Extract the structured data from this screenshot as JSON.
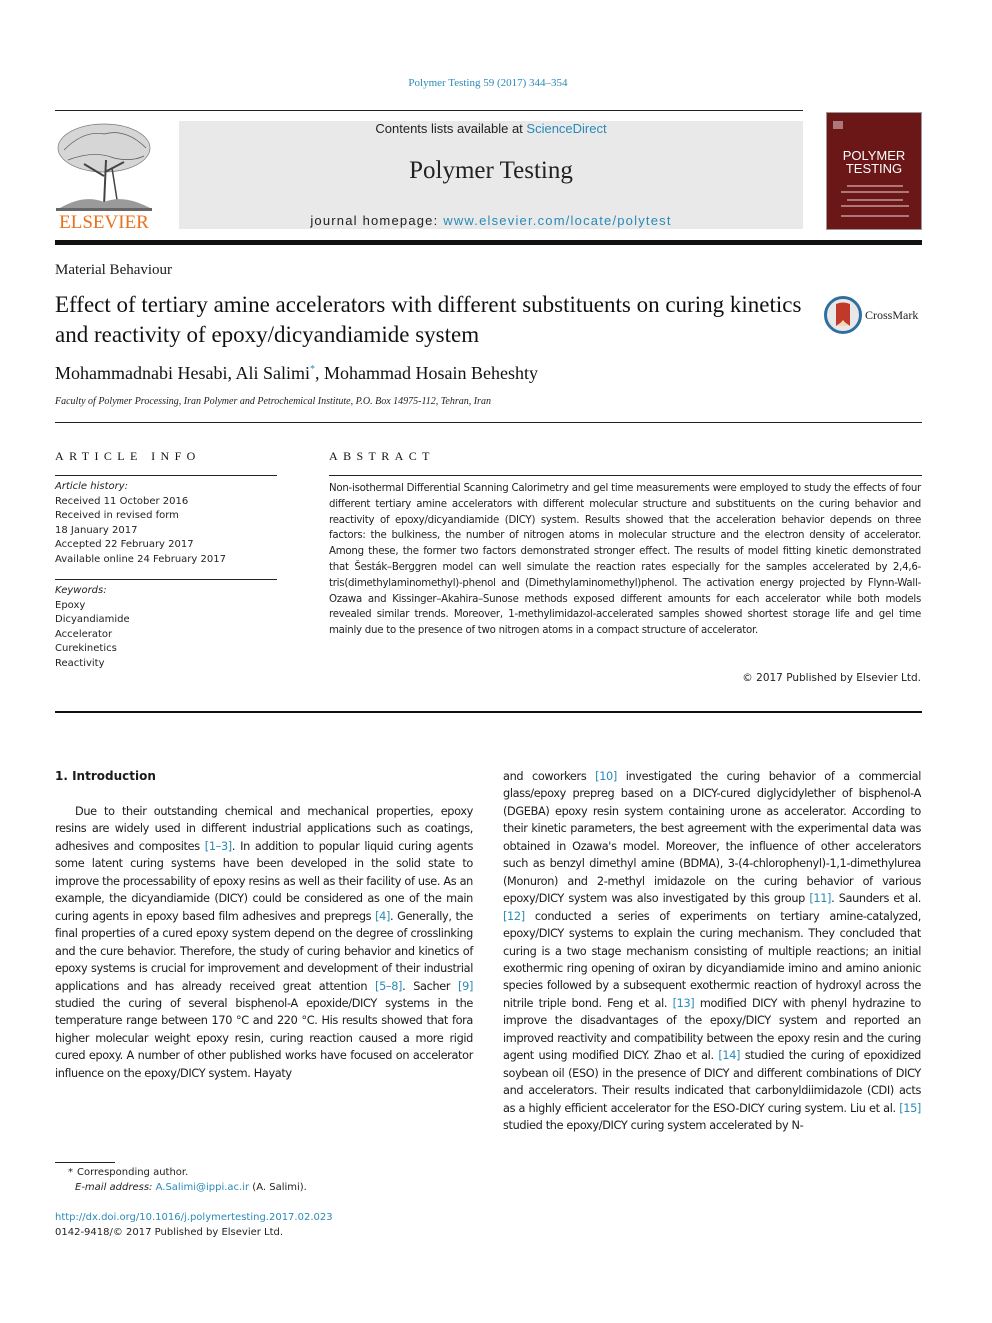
{
  "journal_reference": "Polymer Testing 59 (2017) 344–354",
  "publisher_logo": {
    "icon": "elsevier-tree-icon",
    "wordmark": "ELSEVIER",
    "color": "#e9711c"
  },
  "banner": {
    "contents_prefix": "Contents lists available at ",
    "contents_link": "ScienceDirect",
    "journal_title": "Polymer Testing",
    "homepage_prefix": "journal homepage: ",
    "homepage_link": "www.elsevier.com/locate/polytest"
  },
  "cover": {
    "title_line1": "POLYMER",
    "title_line2": "TESTING",
    "color": "#6b1717"
  },
  "section_label": "Material Behaviour",
  "article_title": "Effect of tertiary amine accelerators with different substituents on curing kinetics and reactivity of epoxy/dicyandiamide system",
  "crossmark": {
    "icon": "crossmark-icon",
    "label": "CrossMark"
  },
  "authors": {
    "author1": "Mohammadnabi Hesabi, ",
    "author2": "Ali Salimi",
    "author2_mark": "*",
    "author3": ", Mohammad Hosain Beheshty"
  },
  "affiliation": "Faculty of Polymer Processing, Iran Polymer and Petrochemical Institute, P.O. Box 14975-112, Tehran, Iran",
  "article_info": {
    "heading": "ARTICLE INFO",
    "history_label": "Article history:",
    "history": [
      "Received 11 October 2016",
      "Received in revised form",
      "18 January 2017",
      "Accepted 22 February 2017",
      "Available online 24 February 2017"
    ],
    "keywords_label": "Keywords:",
    "keywords": [
      "Epoxy",
      "Dicyandiamide",
      "Accelerator",
      "Curekinetics",
      "Reactivity"
    ]
  },
  "abstract": {
    "heading": "ABSTRACT",
    "text": "Non-isothermal Differential Scanning Calorimetry and gel time measurements were employed to study the effects of four different tertiary amine accelerators with different molecular structure and substituents on the curing behavior and reactivity of epoxy/dicyandiamide (DICY) system. Results showed that the acceleration behavior depends on three factors: the bulkiness, the number of nitrogen atoms in molecular structure and the electron density of accelerator. Among these, the former two factors demonstrated stronger effect. The results of model fitting kinetic demonstrated that Šesták–Berggren model can well simulate the reaction rates especially for the samples accelerated by 2,4,6-tris(dimethylaminomethyl)-phenol and (Dimethylaminomethyl)phenol. The activation energy projected by Flynn-Wall-Ozawa and Kissinger–Akahira–Sunose methods exposed different amounts for each accelerator while both models revealed similar trends. Moreover, 1-methylimidazol-accelerated samples showed shortest storage life and gel time mainly due to the presence of two nitrogen atoms in a compact structure of accelerator.",
    "copyright": "© 2017 Published by Elsevier Ltd."
  },
  "introduction": {
    "heading": "1.  Introduction",
    "left_column": [
      {
        "t": "Due to their outstanding chemical and mechanical properties, epoxy resins are widely used in different industrial applications such as coatings, adhesives and composites "
      },
      {
        "c": "[1–3]"
      },
      {
        "t": ". In addition to popular liquid curing agents some latent curing systems have been developed in the solid state to improve the processability of epoxy resins as well as their facility of use. As an example, the dicyandiamide (DICY) could be considered as one of the main curing agents in epoxy based film adhesives and prepregs "
      },
      {
        "c": "[4]"
      },
      {
        "t": ". Generally, the final properties of a cured epoxy system depend on the degree of crosslinking and the cure behavior. Therefore, the study of curing behavior and kinetics of epoxy systems is crucial for improvement and development of their industrial applications and has already received great attention "
      },
      {
        "c": "[5–8]"
      },
      {
        "t": ". Sacher "
      },
      {
        "c": "[9]"
      },
      {
        "t": " studied the curing of several bisphenol-A epoxide/DICY systems in the temperature range between 170 °C and 220 °C. His results showed that fora higher molecular weight epoxy resin, curing reaction caused a more rigid cured epoxy. A number of other published works have focused on accelerator influence on the epoxy/DICY system. Hayaty"
      }
    ],
    "right_column": [
      {
        "t": "and coworkers "
      },
      {
        "c": "[10]"
      },
      {
        "t": " investigated the curing behavior of a commercial glass/epoxy prepreg based on a DICY-cured diglycidylether of bisphenol-A (DGEBA) epoxy resin system containing urone as accelerator. According to their kinetic parameters, the best agreement with the experimental data was obtained in Ozawa's model. Moreover, the influence of other accelerators such as benzyl dimethyl amine (BDMA), 3-(4-chlorophenyl)-1,1-dimethylurea (Monuron) and 2-methyl imidazole on the curing behavior of various epoxy/DICY system was also investigated by this group "
      },
      {
        "c": "[11]"
      },
      {
        "t": ". Saunders et al. "
      },
      {
        "c": "[12]"
      },
      {
        "t": " conducted a series of experiments on tertiary amine-catalyzed, epoxy/DICY systems to explain the curing mechanism. They concluded that curing is a two stage mechanism consisting of multiple reactions; an initial exothermic ring opening of oxiran by dicyandiamide imino and amino anionic species followed by a subsequent exothermic reaction of hydroxyl across the nitrile triple bond. Feng et al. "
      },
      {
        "c": "[13]"
      },
      {
        "t": " modified DICY with phenyl hydrazine to improve the disadvantages of the epoxy/DICY system and reported an improved reactivity and compatibility between the epoxy resin and the curing agent using modified DICY. Zhao et al. "
      },
      {
        "c": "[14]"
      },
      {
        "t": " studied the curing of epoxidized soybean oil (ESO) in the presence of DICY and different combinations of DICY and accelerators. Their results indicated that carbonyldiimidazole (CDI) acts as a highly efficient accelerator for the ESO-DICY curing system. Liu et al. "
      },
      {
        "c": "[15]"
      },
      {
        "t": " studied the epoxy/DICY curing system accelerated by N-"
      }
    ]
  },
  "footnotes": {
    "star": "*",
    "corresponding": "Corresponding author.",
    "email_label": "E-mail address: ",
    "email": "A.Salimi@ippi.ac.ir",
    "email_suffix": " (A. Salimi)."
  },
  "doi": "http://dx.doi.org/10.1016/j.polymertesting.2017.02.023",
  "issn_line": "0142-9418/© 2017 Published by Elsevier Ltd.",
  "colors": {
    "link": "#2a8ab8",
    "banner_bg": "#e9e9e9"
  }
}
